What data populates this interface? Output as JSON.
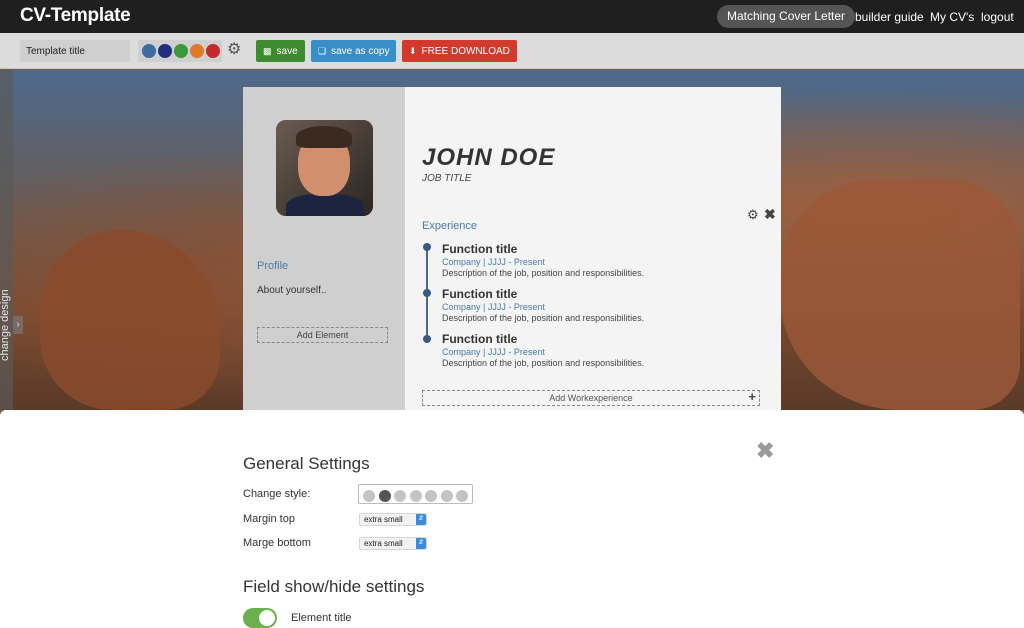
{
  "nav": {
    "logo": "CV-Template",
    "cover_letter": "Matching Cover Letter",
    "builder_guide": "builder guide",
    "my_cvs": "My CV's",
    "logout": "logout"
  },
  "toolbar": {
    "title_value": "Template title",
    "colors": [
      "#3d6d9e",
      "#1f2f7a",
      "#3a9a3a",
      "#e07a2a",
      "#c42a2a"
    ],
    "save_label": "save",
    "save_copy_label": "save as copy",
    "download_label": "FREE DOWNLOAD",
    "accent_save": "#3e8a2e",
    "accent_copy": "#3a8ec8",
    "accent_download": "#d23a2e"
  },
  "side_tab": {
    "label": "change design"
  },
  "cv": {
    "name": "JOHN DOE",
    "job_title": "JOB TITLE",
    "profile_heading": "Profile",
    "profile_text": "About yourself..",
    "add_element": "Add Element",
    "experience_heading": "Experience",
    "jobs": [
      {
        "title": "Function title",
        "company": "Company | JJJJ - Present",
        "desc": "Description of the job, position and responsibilities."
      },
      {
        "title": "Function title",
        "company": "Company | JJJJ - Present",
        "desc": "Description of the job, position and responsibilities."
      },
      {
        "title": "Function title",
        "company": "Company | JJJJ - Present",
        "desc": "Description of the job, position and responsibilities."
      }
    ],
    "add_work": "Add Workexperience"
  },
  "settings": {
    "general_heading": "General Settings",
    "change_style_label": "Change style:",
    "style_options_count": 7,
    "selected_style": 2,
    "margin_top_label": "Margin top",
    "margin_top_value": "extra small",
    "margin_bottom_label": "Marge bottom",
    "margin_bottom_value": "extra small",
    "field_heading": "Field show/hide settings",
    "element_title_label": "Element title",
    "element_title_on": true
  }
}
